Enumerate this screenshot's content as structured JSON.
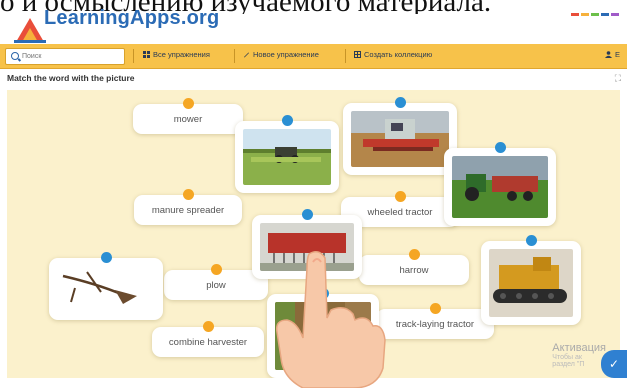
{
  "top_text": "о и осмыслению изучаемого материала.",
  "brand": {
    "name": "LearningApps.org"
  },
  "toolbar": {
    "search_placeholder": "Поиск",
    "all_exercises": "Все упражнения",
    "new_exercise": "Новое упражнение",
    "create_collection": "Создать коллекцию",
    "user_initial": "Е"
  },
  "exercise": {
    "title": "Match the word with the picture",
    "fullscreen_glyph": "⛶"
  },
  "labels": {
    "mower": "mower",
    "manure_spreader": "manure spreader",
    "wheeled_tractor": "wheeled tractor",
    "harrow": "harrow",
    "plow": "plow",
    "combine_harvester": "combine harvester",
    "track_laying_tractor": "track-laying tractor"
  },
  "pictures": [
    "mower-picture",
    "combine-picture",
    "manure-spreader-picture",
    "harrow-picture",
    "plow-picture",
    "crawler-tractor-picture",
    "field-picture"
  ],
  "watermark": {
    "title": "Активация",
    "line1": "Чтобы ак",
    "line2": "раздел \"П"
  },
  "colors": {
    "toolbar": "#f7c24a",
    "board": "#fbf1cc",
    "pin_orange": "#f5a623",
    "pin_blue": "#2a8fd3",
    "brand": "#2b6bb5"
  }
}
